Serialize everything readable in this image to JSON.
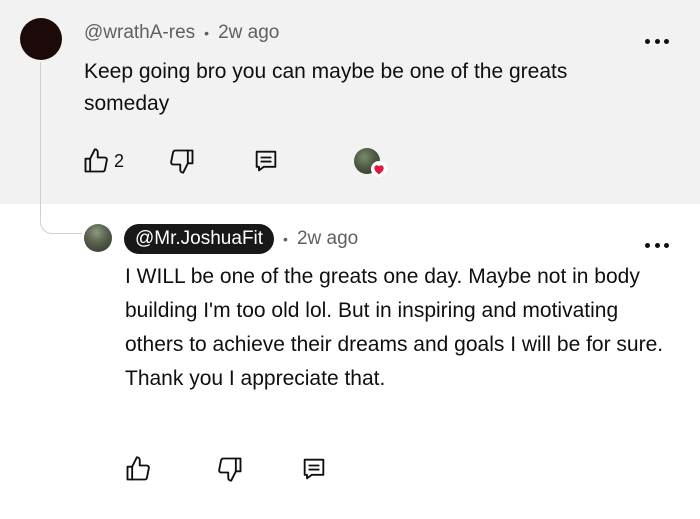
{
  "parent_comment": {
    "author": "@wrathA-res",
    "separator": "•",
    "time": "2w ago",
    "text": "Keep going bro you can maybe be one of the greats someday",
    "like_count": "2"
  },
  "reply": {
    "author": "@Mr.JoshuaFit",
    "separator": "•",
    "time": "2w ago",
    "text": "I WILL be one of the greats one day. Maybe not in body building I'm too old lol. But in inspiring and motivating others to achieve their dreams and goals I will be for sure. Thank you I appreciate that."
  },
  "icons": {
    "like": "thumbs-up-icon",
    "dislike": "thumbs-down-icon",
    "reply": "reply-comment-icon",
    "more": "more-vertical-dots-icon",
    "creator_heart": "creator-heart-icon"
  },
  "colors": {
    "highlight_bg": "#f2f2f2",
    "heart": "#e3173e",
    "pill_bg": "#181818"
  }
}
